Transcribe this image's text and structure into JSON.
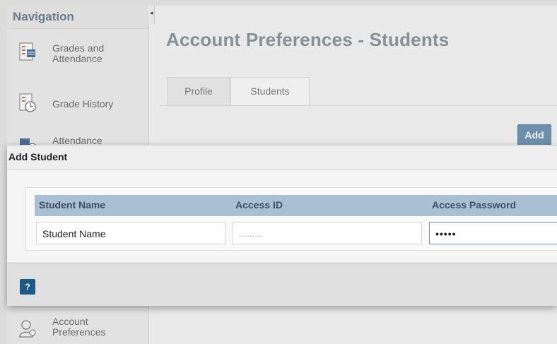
{
  "sidebar": {
    "title": "Navigation",
    "items": [
      {
        "label_line1": "Grades and",
        "label_line2": "Attendance",
        "icon": "grades-attendance-icon"
      },
      {
        "label_line1": "Grade History",
        "label_line2": "",
        "icon": "grade-history-icon"
      },
      {
        "label_line1": "Attendance",
        "label_line2": "",
        "icon": "attendance-icon"
      },
      {
        "label_line1": "Account",
        "label_line2": "Preferences",
        "icon": "account-preferences-icon"
      }
    ]
  },
  "page": {
    "title": "Account Preferences - Students",
    "tabs": [
      "Profile",
      "Students"
    ],
    "active_tab": "Students",
    "add_button": "Add"
  },
  "dialog": {
    "title": "Add Student",
    "columns": [
      "Student Name",
      "Access ID",
      "Access Password"
    ],
    "fields": {
      "student_name": "Student Name",
      "access_id": "………",
      "access_password": "•••••"
    },
    "help_button": "?"
  },
  "colors": {
    "accent": "#6e8fab",
    "table_header": "#a9bfd4",
    "help_button": "#1f5a86"
  }
}
